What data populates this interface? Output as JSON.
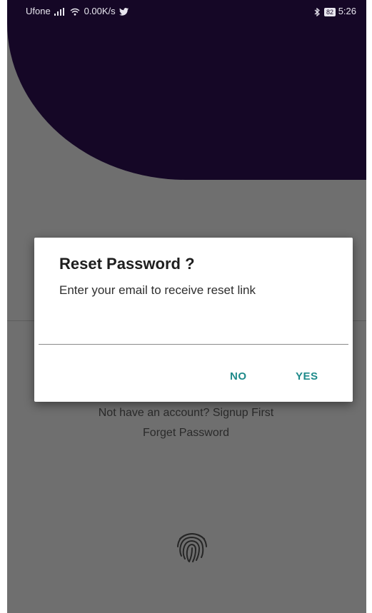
{
  "status_bar": {
    "carrier": "Ufone",
    "network_speed": "0.00K/s",
    "battery": "82",
    "time": "5:26"
  },
  "background": {
    "signup_link": "Not have an account? Signup First",
    "forgot_link": "Forget Password"
  },
  "dialog": {
    "title": "Reset Password ?",
    "message": "Enter your email to receive reset link",
    "email_value": "",
    "no_label": "NO",
    "yes_label": "YES"
  },
  "colors": {
    "header": "#150726",
    "scrim": "#6f6f6f",
    "accent": "#1e8a8a"
  }
}
